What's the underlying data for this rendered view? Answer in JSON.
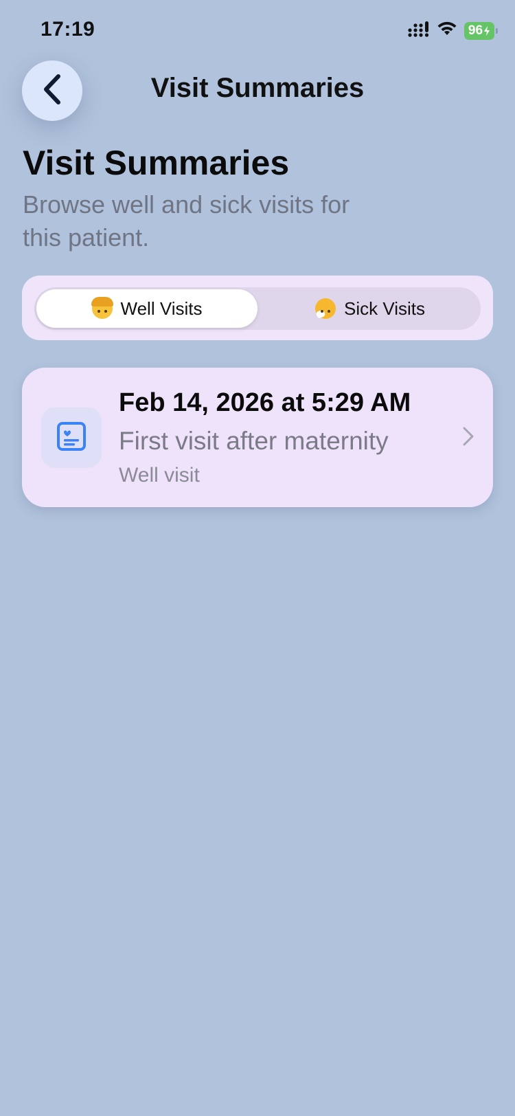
{
  "status_bar": {
    "time": "17:19",
    "battery": "96",
    "icons": [
      "signal-icon",
      "wifi-icon",
      "battery-charging-icon"
    ]
  },
  "nav": {
    "back_icon": "chevron-left-icon",
    "title": "Visit Summaries"
  },
  "header": {
    "title": "Visit Summaries",
    "subtitle": "Browse well and sick visits for this patient."
  },
  "segments": [
    {
      "label": "Well Visits",
      "icon": "child-face-emoji",
      "selected": true
    },
    {
      "label": "Sick Visits",
      "icon": "sick-face-emoji",
      "selected": false
    }
  ],
  "visits": [
    {
      "date": "Feb 14, 2026 at 5:29 AM",
      "title": "First visit after maternity",
      "type": "Well visit",
      "icon": "medical-record-icon"
    }
  ],
  "colors": {
    "background": "#b0c2dc",
    "card": "#eee3fb",
    "accent": "#3b82f6",
    "battery": "#65c466"
  }
}
